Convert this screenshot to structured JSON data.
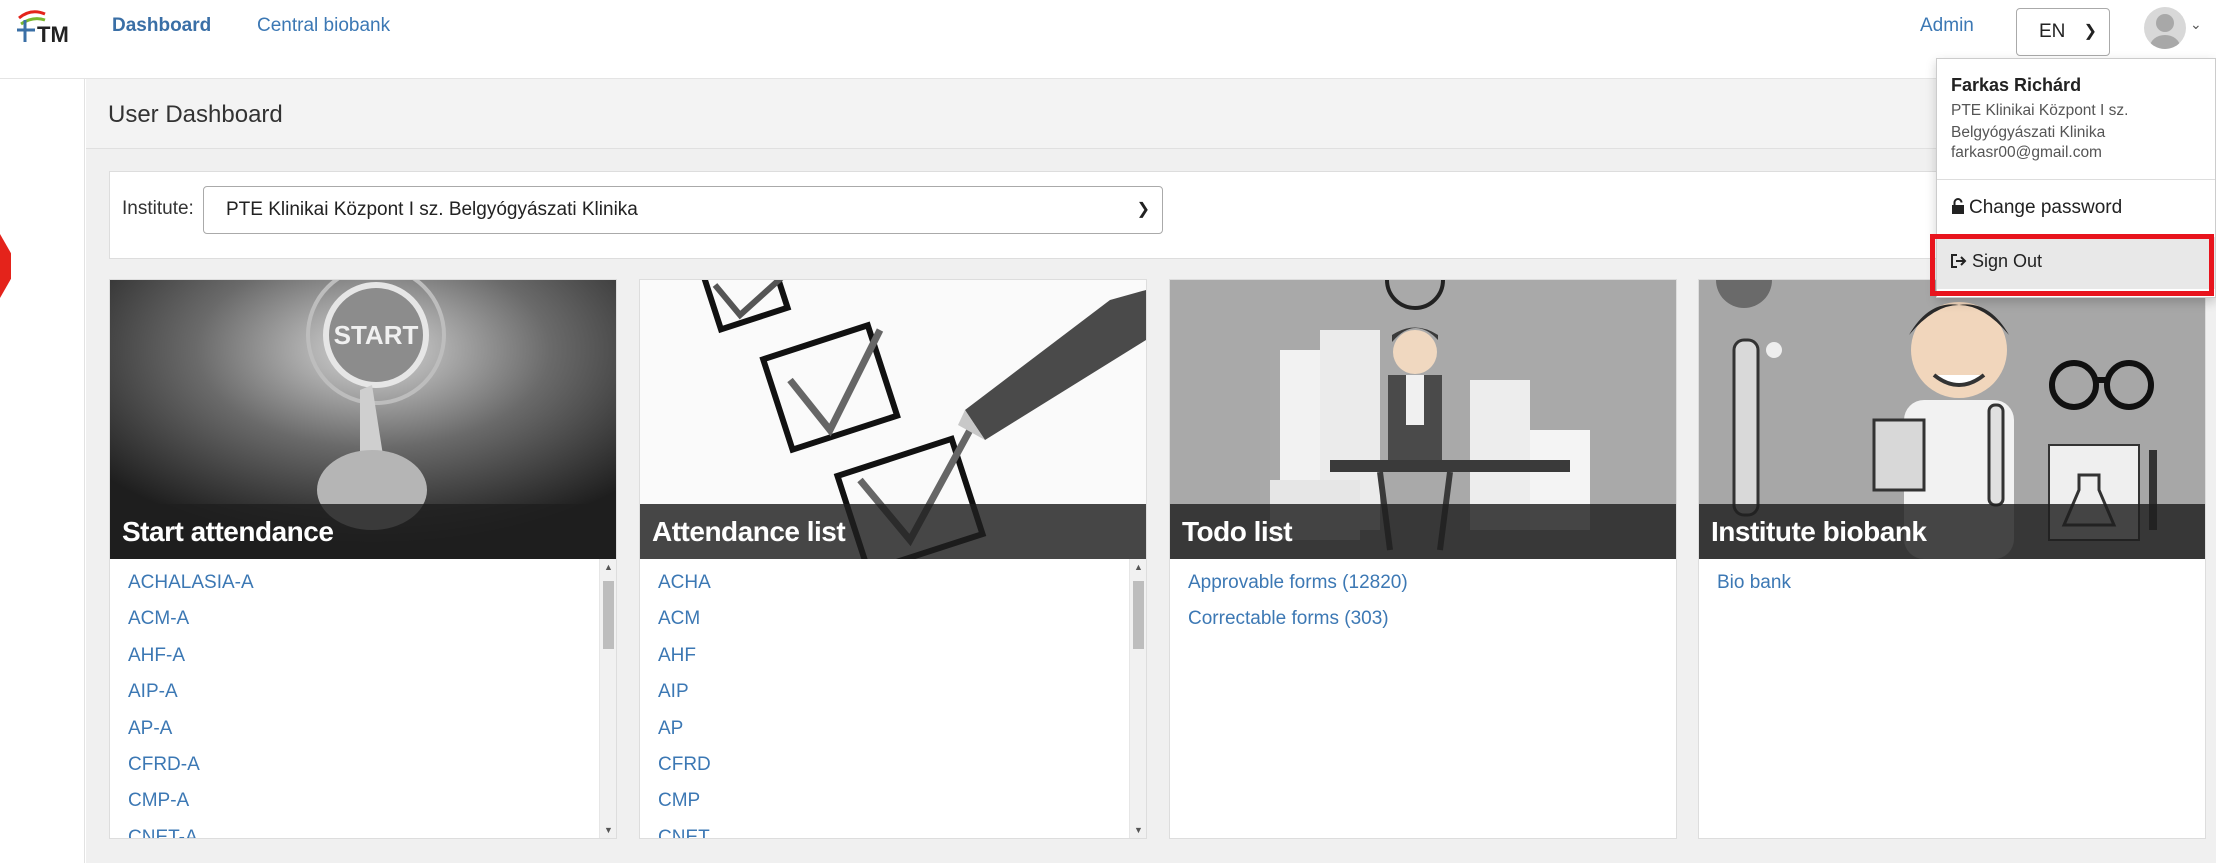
{
  "navbar": {
    "dashboard": "Dashboard",
    "central_biobank": "Central biobank",
    "admin": "Admin",
    "language": "EN"
  },
  "page": {
    "title": "User Dashboard",
    "institute_label": "Institute:",
    "institute_value": "PTE Klinikai Központ I sz. Belgyógyászati Klinika"
  },
  "cards": {
    "start": {
      "title": "Start attendance",
      "image_text": "START",
      "items": [
        "ACHALASIA-A",
        "ACM-A",
        "AHF-A",
        "AIP-A",
        "AP-A",
        "CFRD-A",
        "CMP-A",
        "CNET-A"
      ]
    },
    "attlist": {
      "title": "Attendance list",
      "items": [
        "ACHA",
        "ACM",
        "AHF",
        "AIP",
        "AP",
        "CFRD",
        "CMP",
        "CNET"
      ]
    },
    "todo": {
      "title": "Todo list",
      "items": [
        "Approvable forms (12820)",
        "Correctable forms (303)"
      ]
    },
    "biobank": {
      "title": "Institute biobank",
      "items": [
        "Bio bank"
      ]
    }
  },
  "user_menu": {
    "name": "Farkas Richárd",
    "org_line1": "PTE Klinikai Központ I sz.",
    "org_line2": "Belgyógyászati Klinika",
    "email": "farkasr00@gmail.com",
    "change_password": "Change password",
    "sign_out": "Sign Out"
  },
  "colors": {
    "link": "#3c78b4",
    "highlight": "#e8141d"
  }
}
